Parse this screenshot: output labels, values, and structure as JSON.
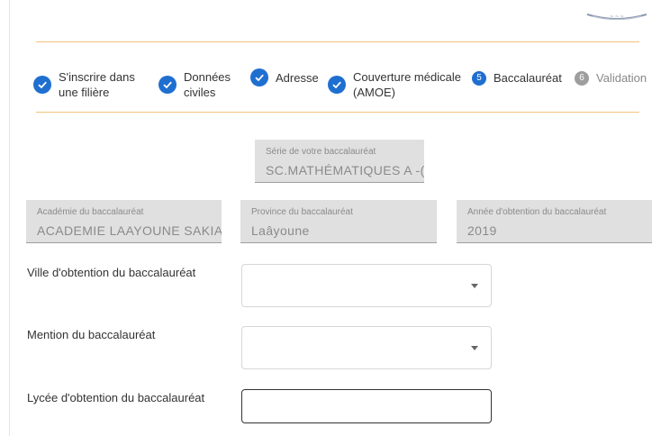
{
  "stepper": {
    "steps": [
      {
        "label_line1": "S'inscrire dans",
        "label_line2": "une filière",
        "status": "done"
      },
      {
        "label_line1": "Données",
        "label_line2": "civiles",
        "status": "done"
      },
      {
        "label_line1": "Adresse",
        "label_line2": "",
        "status": "done"
      },
      {
        "label_line1": "Couverture médicale",
        "label_line2": "(AMOE)",
        "status": "done"
      },
      {
        "number": "5",
        "label_line1": "Baccalauréat",
        "status": "active"
      },
      {
        "number": "6",
        "label_line1": "Validation",
        "status": "pending"
      }
    ]
  },
  "colors": {
    "accent": "#1f6fd1",
    "divider": "#f2c27a",
    "disabled_bg": "#e0e0e0"
  },
  "bac_serie": {
    "label": "Série de votre baccalauréat",
    "value": "SC.MATHÉMATIQUES A -("
  },
  "bac_academie": {
    "label": "Académie du baccalauréat",
    "value": "ACADEMIE LAAYOUNE SAKIA"
  },
  "bac_province": {
    "label": "Province du baccalauréat",
    "value": "Laâyoune"
  },
  "bac_annee": {
    "label": "Année d'obtention du baccalauréat",
    "value": "2019"
  },
  "ville": {
    "label": "Ville d'obtention du baccalauréat",
    "value": ""
  },
  "mention": {
    "label": "Mention du baccalauréat",
    "value": ""
  },
  "lycee": {
    "label": "Lycée d'obtention du baccalauréat",
    "value": ""
  }
}
